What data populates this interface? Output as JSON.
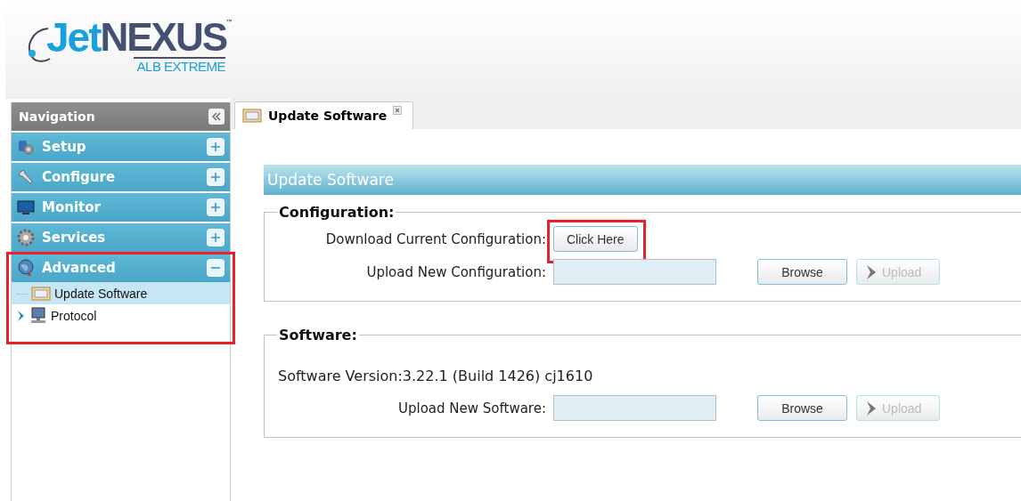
{
  "logo": {
    "name_part_1": "Jet",
    "name_part_2": "NEXUS",
    "trademark": "™",
    "tagline": "ALB EXTREME"
  },
  "navigation": {
    "title": "Navigation",
    "sections": [
      {
        "label": "Setup",
        "expanded": false,
        "highlighted": false
      },
      {
        "label": "Configure",
        "expanded": false,
        "highlighted": false
      },
      {
        "label": "Monitor",
        "expanded": false,
        "highlighted": false
      },
      {
        "label": "Services",
        "expanded": false,
        "highlighted": false
      },
      {
        "label": "Advanced",
        "expanded": true,
        "highlighted": true,
        "children": [
          {
            "label": "Update Software",
            "selected": true,
            "has_children": false
          },
          {
            "label": "Protocol",
            "selected": false,
            "has_children": true
          }
        ]
      }
    ]
  },
  "tabs": [
    {
      "label": "Update Software",
      "selected": true
    }
  ],
  "panel": {
    "title": "Update Software",
    "fieldsets": [
      {
        "legend": "Configuration:",
        "rows": [
          {
            "kind": "button",
            "label": "Download Current Configuration:",
            "button": "Click Here",
            "highlighted": true
          },
          {
            "kind": "upload",
            "label": "Upload New Configuration:",
            "browse": "Browse",
            "upload": "Upload",
            "upload_disabled": true
          }
        ]
      },
      {
        "legend": "Software:",
        "rows": [
          {
            "kind": "text",
            "text": "Software Version:3.22.1 (Build 1426) cj1610"
          },
          {
            "kind": "upload",
            "label": "Upload New Software:",
            "browse": "Browse",
            "upload": "Upload",
            "upload_disabled": true
          }
        ]
      }
    ]
  }
}
